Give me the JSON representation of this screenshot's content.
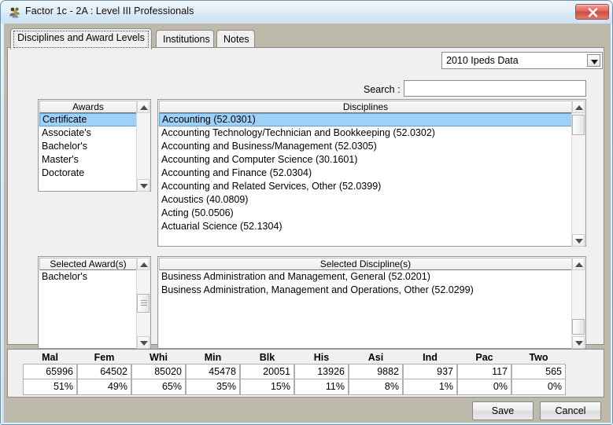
{
  "window": {
    "title": "Factor 1c - 2A : Level III Professionals",
    "icon": "people-group-icon",
    "close_label": "x"
  },
  "tabs": [
    {
      "label": "Disciplines and Award Levels",
      "active": true
    },
    {
      "label": "Institutions",
      "active": false
    },
    {
      "label": "Notes",
      "active": false
    }
  ],
  "dataset": {
    "selected": "2010 Ipeds Data",
    "arrow": "chevron-down-icon"
  },
  "search": {
    "label": "Search :",
    "value": "",
    "placeholder": ""
  },
  "awards": {
    "header": "Awards",
    "items": [
      "Certificate",
      "Associate's",
      "Bachelor's",
      "Master's",
      "Doctorate"
    ],
    "selected_index": 0
  },
  "disciplines": {
    "header": "Disciplines",
    "items": [
      "Accounting (52.0301)",
      "Accounting Technology/Technician and Bookkeeping (52.0302)",
      "Accounting and Business/Management (52.0305)",
      "Accounting and Computer Science (30.1601)",
      "Accounting and Finance (52.0304)",
      "Accounting and Related Services, Other (52.0399)",
      "Acoustics (40.0809)",
      "Acting (50.0506)",
      "Actuarial Science (52.1304)"
    ],
    "selected_index": 0
  },
  "selected_awards": {
    "header": "Selected Award(s)",
    "items": [
      "Bachelor's"
    ]
  },
  "selected_disciplines": {
    "header": "Selected Discipline(s)",
    "items": [
      "Business Administration and Management, General (52.0201)",
      "Business Administration, Management and Operations, Other (52.0299)"
    ]
  },
  "stats": {
    "columns": [
      {
        "header": "Mal",
        "count": "65996",
        "percent": "51%"
      },
      {
        "header": "Fem",
        "count": "64502",
        "percent": "49%"
      },
      {
        "header": "Whi",
        "count": "85020",
        "percent": "65%"
      },
      {
        "header": "Min",
        "count": "45478",
        "percent": "35%"
      },
      {
        "header": "Blk",
        "count": "20051",
        "percent": "15%"
      },
      {
        "header": "His",
        "count": "13926",
        "percent": "11%"
      },
      {
        "header": "Asi",
        "count": "9882",
        "percent": "8%"
      },
      {
        "header": "Ind",
        "count": "937",
        "percent": "1%"
      },
      {
        "header": "Pac",
        "count": "117",
        "percent": "0%"
      },
      {
        "header": "Two",
        "count": "565",
        "percent": "0%"
      }
    ]
  },
  "footer": {
    "save_label": "Save",
    "cancel_label": "Cancel"
  },
  "colors": {
    "selection": "#9fd0f5",
    "titlebar": "#dae9f6",
    "client": "#bdb9ab",
    "panel": "#f0f0f0"
  }
}
